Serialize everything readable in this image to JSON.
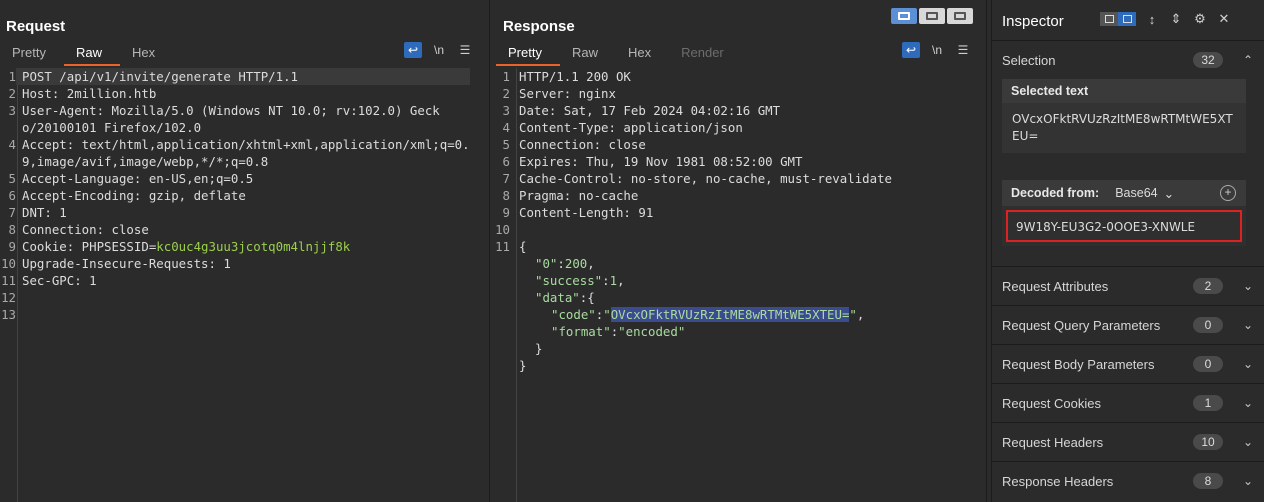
{
  "request": {
    "title": "Request",
    "tabs": [
      "Pretty",
      "Raw",
      "Hex"
    ],
    "active_tab": "Raw",
    "icons": [
      "wrap-icon",
      "newline-icon",
      "menu-icon"
    ],
    "newline_label": "\\n",
    "lines": [
      {
        "n": "1",
        "text": "POST /api/v1/invite/generate HTTP/1.1"
      },
      {
        "n": "2",
        "text": "Host: 2million.htb"
      },
      {
        "n": "3",
        "text": "User-Agent: Mozilla/5.0 (Windows NT 10.0; rv:102.0) Gecko/20100101 Firefox/102.0"
      },
      {
        "n": "4",
        "text": "Accept: text/html,application/xhtml+xml,application/xml;q=0.9,image/avif,image/webp,*/*;q=0.8"
      },
      {
        "n": "5",
        "text": "Accept-Language: en-US,en;q=0.5"
      },
      {
        "n": "6",
        "text": "Accept-Encoding: gzip, deflate"
      },
      {
        "n": "7",
        "text": "DNT: 1"
      },
      {
        "n": "8",
        "text": "Connection: close"
      },
      {
        "n": "9",
        "cookie_name": "Cookie: PHPSESSID=",
        "cookie_value": "kc0uc4g3uu3jcotq0m4lnjjf8k"
      },
      {
        "n": "10",
        "text": "Upgrade-Insecure-Requests: 1"
      },
      {
        "n": "11",
        "text": "Sec-GPC: 1"
      },
      {
        "n": "12",
        "text": ""
      },
      {
        "n": "13",
        "text": ""
      }
    ]
  },
  "response": {
    "title": "Response",
    "tabs": [
      "Pretty",
      "Raw",
      "Hex",
      "Render"
    ],
    "active_tab": "Pretty",
    "newline_label": "\\n",
    "lines": [
      {
        "n": "1",
        "text": "HTTP/1.1 200 OK"
      },
      {
        "n": "2",
        "text": "Server: nginx"
      },
      {
        "n": "3",
        "text": "Date: Sat, 17 Feb 2024 04:02:16 GMT"
      },
      {
        "n": "4",
        "text": "Content-Type: application/json"
      },
      {
        "n": "5",
        "text": "Connection: close"
      },
      {
        "n": "6",
        "text": "Expires: Thu, 19 Nov 1981 08:52:00 GMT"
      },
      {
        "n": "7",
        "text": "Cache-Control: no-store, no-cache, must-revalidate"
      },
      {
        "n": "8",
        "text": "Pragma: no-cache"
      },
      {
        "n": "9",
        "text": "Content-Length: 91"
      },
      {
        "n": "10",
        "text": ""
      },
      {
        "n": "11",
        "text": "{"
      }
    ],
    "json": {
      "key0": "\"0\"",
      "val0": "200",
      "key_success": "\"success\"",
      "val_success": "1",
      "key_data": "\"data\"",
      "open_brace": "{",
      "key_code": "\"code\"",
      "val_code_open": "\"",
      "val_code": "OVcxOFktRVUzRzItME8wRTMtWE5XTEU=",
      "val_code_close": "\"",
      "key_format": "\"format\"",
      "val_format": "\"encoded\"",
      "close_inner": "}",
      "close_outer": "}",
      "colon": ":",
      "comma": ","
    }
  },
  "inspector": {
    "title": "Inspector",
    "selection_label": "Selection",
    "selection_count": "32",
    "selected_text_label": "Selected text",
    "selected_text": "OVcxOFktRVUzRzItME8wRTMtWE5XTEU=",
    "decoded_from_label": "Decoded from:",
    "decoder": "Base64",
    "decoded_value": "9W18Y-EU3G2-0OOE3-XNWLE",
    "sections": [
      {
        "label": "Request Attributes",
        "count": "2"
      },
      {
        "label": "Request Query Parameters",
        "count": "0"
      },
      {
        "label": "Request Body Parameters",
        "count": "0"
      },
      {
        "label": "Request Cookies",
        "count": "1"
      },
      {
        "label": "Request Headers",
        "count": "10"
      },
      {
        "label": "Response Headers",
        "count": "8"
      }
    ]
  },
  "colors": {
    "accent_tab": "#e9632a",
    "selection_highlight": "#3c4a8f",
    "decoded_border": "#dd2222",
    "toggle_active": "#2f6bbd"
  }
}
